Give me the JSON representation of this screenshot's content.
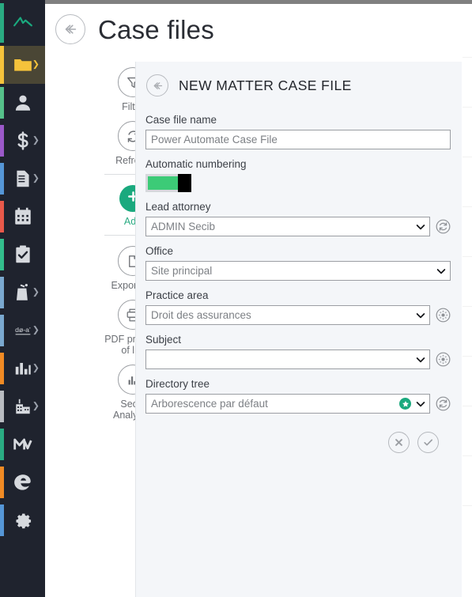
{
  "rail": {
    "items": [
      {
        "name": "logo",
        "icon": "secib-logo-icon",
        "accent": "#2aab82",
        "chevron": false,
        "selected": false
      },
      {
        "name": "case-files",
        "icon": "folder-icon",
        "accent": "#f5c33b",
        "chevron": true,
        "selected": true
      },
      {
        "name": "contacts",
        "icon": "person-icon",
        "accent": "#55c08a",
        "chevron": false,
        "selected": false
      },
      {
        "name": "billing",
        "icon": "dollar-icon",
        "accent": "#9b59c9",
        "chevron": true,
        "selected": false
      },
      {
        "name": "documents",
        "icon": "document-icon",
        "accent": "#5596d6",
        "chevron": true,
        "selected": false
      },
      {
        "name": "calendar",
        "icon": "calendar-icon",
        "accent": "#e8594a",
        "chevron": false,
        "selected": false
      },
      {
        "name": "tasks",
        "icon": "checklist-icon",
        "accent": "#33bd8c",
        "chevron": false,
        "selected": false
      },
      {
        "name": "court",
        "icon": "courthouse-bag-icon",
        "accent": "#7aa8cf",
        "chevron": true,
        "selected": false
      },
      {
        "name": "glossary",
        "icon": "dictionary-icon",
        "accent": "#7aa8cf",
        "chevron": true,
        "selected": false
      },
      {
        "name": "reports",
        "icon": "bar-chart-icon",
        "accent": "#f08a24",
        "chevron": true,
        "selected": false
      },
      {
        "name": "firm",
        "icon": "building-icon",
        "accent": "#b9bcc1",
        "chevron": true,
        "selected": false
      },
      {
        "name": "marketing",
        "icon": "mw-icon",
        "accent": "#2aab82",
        "chevron": false,
        "selected": false
      },
      {
        "name": "edge-browser",
        "icon": "edge-icon",
        "accent": "#f08a24",
        "chevron": false,
        "selected": false
      },
      {
        "name": "settings",
        "icon": "gear-icon",
        "accent": "#5596d6",
        "chevron": false,
        "selected": false
      }
    ]
  },
  "header": {
    "back_icon": "back-arrow-circle-icon",
    "title": "Case files"
  },
  "actions": [
    {
      "id": "filter",
      "label": "Filter",
      "icon": "funnel-icon",
      "badge": "star-icon",
      "style": "outline",
      "divider_after": false
    },
    {
      "id": "refresh",
      "label": "Refresh",
      "icon": "refresh-icon",
      "badge": null,
      "style": "outline",
      "divider_after": true
    },
    {
      "id": "add",
      "label": "Add",
      "icon": "plus-icon",
      "badge": null,
      "style": "solid",
      "divider_after": true
    },
    {
      "id": "export-list",
      "label": "Export list",
      "icon": "page-export-icon",
      "badge": null,
      "style": "outline",
      "divider_after": false
    },
    {
      "id": "pdf-preview",
      "label": "PDF preview\nof list",
      "icon": "printer-icon",
      "badge": null,
      "style": "outline",
      "divider_after": false
    },
    {
      "id": "secib-analytics",
      "label": "Secib\nAnalytics",
      "icon": "analytics-icon",
      "badge": null,
      "style": "outline",
      "divider_after": false
    }
  ],
  "form": {
    "back_icon": "back-arrow-circle-icon",
    "title": "NEW MATTER CASE FILE",
    "fields": {
      "case_file_name": {
        "label": "Case file name",
        "value": "Power Automate Case File",
        "placeholder": "Power Automate Case File"
      },
      "automatic_numbering": {
        "label": "Automatic numbering",
        "state": "on",
        "on_color": "#3ccb77"
      },
      "lead_attorney": {
        "label": "Lead attorney",
        "value": "ADMIN Secib",
        "side_icon": "refresh-icon"
      },
      "office": {
        "label": "Office",
        "value": "Site principal",
        "side_icon": null
      },
      "practice_area": {
        "label": "Practice area",
        "value": "Droit des assurances",
        "side_icon": "gear-icon"
      },
      "subject": {
        "label": "Subject",
        "value": "",
        "side_icon": "gear-icon"
      },
      "directory_tree": {
        "label": "Directory tree",
        "value": "Arborescence par défaut",
        "inline_icon": "green-star-icon",
        "side_icon": "refresh-icon"
      }
    },
    "footer": {
      "cancel_icon": "cancel-circle-icon",
      "confirm_icon": "check-circle-icon"
    }
  },
  "right_strip": {
    "rows": [
      {
        "highlight": "#f5c53c"
      },
      {
        "highlight": "#fdf7e3"
      },
      {
        "highlight": "#fdf7e3"
      },
      {
        "highlight": "#fdf7e3"
      },
      {
        "highlight": "#fdf7e3"
      },
      {
        "highlight": "#fdf7e3"
      },
      {
        "highlight": "#fdf7e3"
      },
      {
        "highlight": "#fdf7e3"
      },
      {
        "highlight": "#fdf7e3"
      },
      {
        "highlight": "#fdf7e3"
      }
    ]
  }
}
